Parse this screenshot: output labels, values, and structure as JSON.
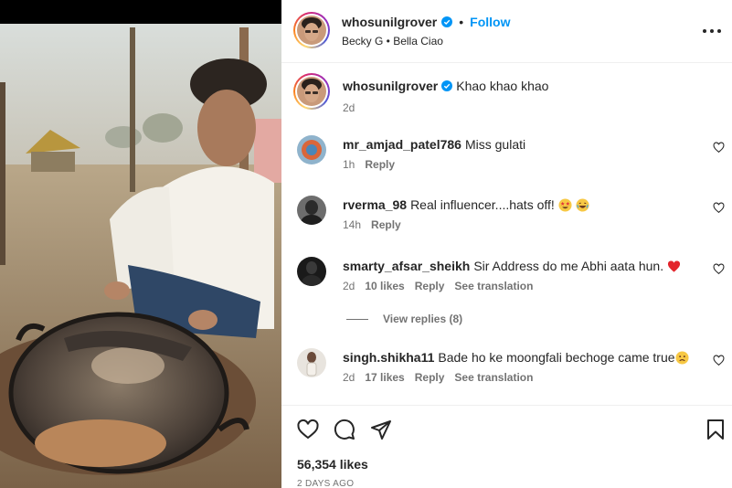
{
  "post": {
    "author": "whosunilgrover",
    "follow_label": "Follow",
    "separator": "•",
    "audio": "Becky G • Bella Ciao",
    "caption_text": "Khao khao khao",
    "caption_time": "2d",
    "likes": "56,354 likes",
    "date": "2 DAYS AGO"
  },
  "comments": [
    {
      "user": "mr_amjad_patel786",
      "text": "Miss gulati",
      "time": "1h",
      "likes": "",
      "reply": "Reply",
      "translation": "",
      "emoji": []
    },
    {
      "user": "rverma_98",
      "text": "Real influencer....hats off!",
      "time": "14h",
      "likes": "",
      "reply": "Reply",
      "translation": "",
      "emoji": [
        "star-struck-emoji",
        "laughing-emoji"
      ]
    },
    {
      "user": "smarty_afsar_sheikh",
      "text": "Sir Address do me Abhi aata hun.",
      "time": "2d",
      "likes": "10 likes",
      "reply": "Reply",
      "translation": "See translation",
      "emoji": [
        "red-heart-emoji"
      ]
    },
    {
      "user": "singh.shikha11",
      "text": "Bade ho ke moongfali bechoge came true",
      "time": "2d",
      "likes": "17 likes",
      "reply": "Reply",
      "translation": "See translation",
      "emoji": [
        "sad-face-emoji"
      ]
    }
  ],
  "view_replies": "View replies (8)",
  "icons": {
    "verified": "verified-badge-icon",
    "more": "more-options-icon",
    "like": "heart-icon",
    "comment": "comment-icon",
    "share": "share-icon",
    "save": "bookmark-icon"
  },
  "colors": {
    "link_blue": "#0095f6",
    "verified_blue": "#0095f6",
    "text": "#262626",
    "secondary_text": "#737373",
    "divider": "#efefef"
  }
}
